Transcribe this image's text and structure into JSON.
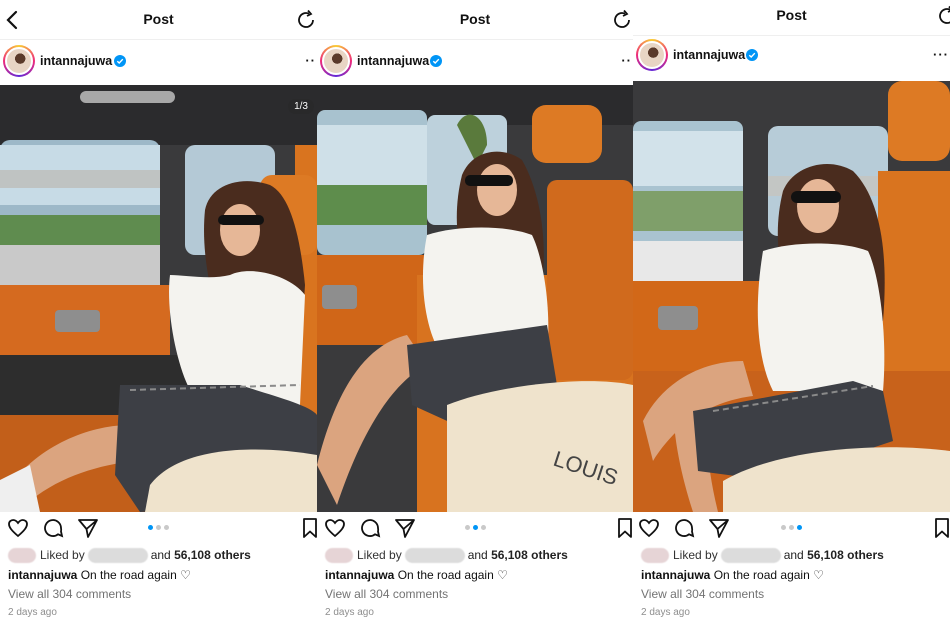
{
  "header": {
    "title": "Post"
  },
  "user": {
    "username": "intannajuwa"
  },
  "colors": {
    "accent": "#0095f6",
    "verified": "#0095f6",
    "seat": "#d56a1f"
  },
  "icons": [
    "back-arrow-icon",
    "refresh-icon",
    "verified-icon",
    "more-icon",
    "heart-icon",
    "comment-icon",
    "share-icon",
    "bookmark-icon"
  ],
  "panels": [
    {
      "counter": "1/3",
      "active_slide": 0
    },
    {
      "active_slide": 1
    },
    {
      "active_slide": 2
    }
  ],
  "likes": {
    "prefix": "Liked by",
    "connector": "and",
    "count": "56,108 others"
  },
  "caption": {
    "text": "On the road again ♡"
  },
  "comments": {
    "link": "View all 304 comments"
  },
  "timestamp": "2 days ago"
}
